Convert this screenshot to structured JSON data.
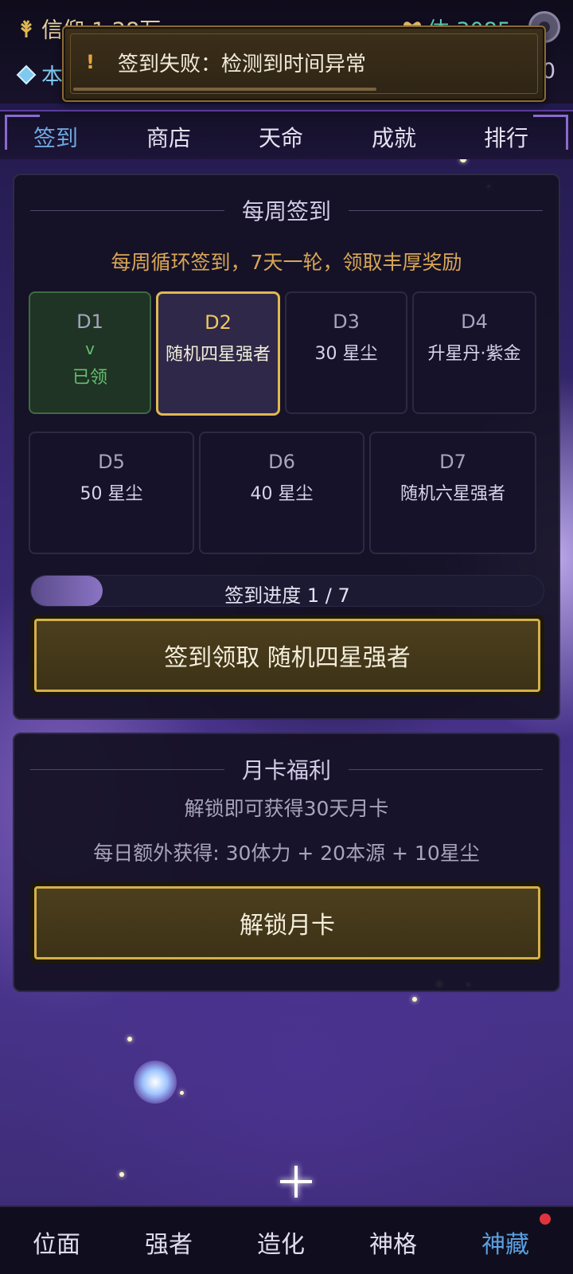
{
  "topbar": {
    "faith": "信仰:1.28万",
    "stamina": "体:3085",
    "source": "本",
    "right_value": "0"
  },
  "toast": {
    "icon": "!",
    "message": "签到失败：检测到时间异常",
    "progress": 0.63
  },
  "tabs": [
    "签到",
    "商店",
    "天命",
    "成就",
    "排行"
  ],
  "weekly": {
    "title": "每周签到",
    "subtitle": "每周循环签到，7天一轮，领取丰厚奖励",
    "days": [
      {
        "day": "D1",
        "reward": "已领",
        "mark": "v"
      },
      {
        "day": "D2",
        "reward": "随机四星强者"
      },
      {
        "day": "D3",
        "reward": "30 星尘"
      },
      {
        "day": "D4",
        "reward": "升星丹·紫金"
      },
      {
        "day": "D5",
        "reward": "50 星尘"
      },
      {
        "day": "D6",
        "reward": "40 星尘"
      },
      {
        "day": "D7",
        "reward": "随机六星强者"
      }
    ],
    "progress_label": "签到进度  1 / 7",
    "progress_fraction": 0.14,
    "claim_button": "签到领取  随机四星强者"
  },
  "monthly": {
    "title": "月卡福利",
    "line1": "解锁即可获得30天月卡",
    "line2": "每日额外获得: 30体力 + 20本源 + 10星尘",
    "unlock_button": "解锁月卡"
  },
  "bottom_nav": [
    "位面",
    "强者",
    "造化",
    "神格",
    "神藏"
  ],
  "colors": {
    "accent_gold": "#e0b850",
    "active_tab": "#6fa8e0",
    "claimed_green": "#66c070",
    "notification_dot": "#e0343c"
  }
}
